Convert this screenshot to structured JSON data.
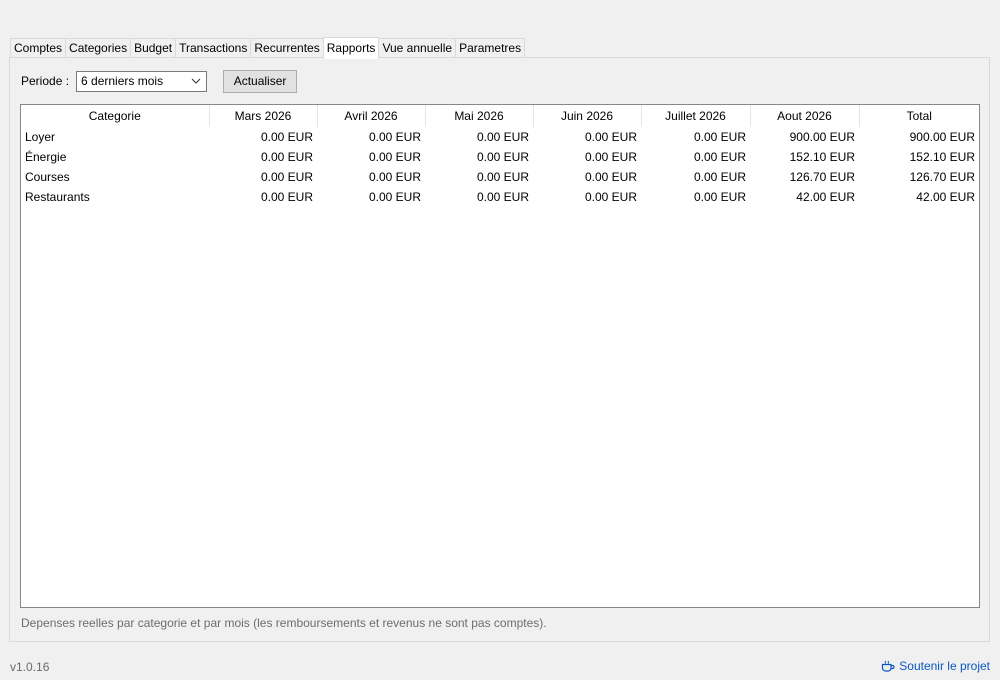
{
  "tabs": [
    "Comptes",
    "Categories",
    "Budget",
    "Transactions",
    "Recurrentes",
    "Rapports",
    "Vue annuelle",
    "Parametres"
  ],
  "active_tab": "Rapports",
  "filter": {
    "label": "Periode :",
    "selected": "6 derniers mois",
    "refresh_label": "Actualiser"
  },
  "table": {
    "headers": [
      "Categorie",
      "Mars 2026",
      "Avril 2026",
      "Mai 2026",
      "Juin 2026",
      "Juillet 2026",
      "Aout 2026",
      "Total"
    ],
    "rows": [
      [
        "Loyer",
        "0.00 EUR",
        "0.00 EUR",
        "0.00 EUR",
        "0.00 EUR",
        "0.00 EUR",
        "900.00 EUR",
        "900.00 EUR"
      ],
      [
        "Énergie",
        "0.00 EUR",
        "0.00 EUR",
        "0.00 EUR",
        "0.00 EUR",
        "0.00 EUR",
        "152.10 EUR",
        "152.10 EUR"
      ],
      [
        "Courses",
        "0.00 EUR",
        "0.00 EUR",
        "0.00 EUR",
        "0.00 EUR",
        "0.00 EUR",
        "126.70 EUR",
        "126.70 EUR"
      ],
      [
        "Restaurants",
        "0.00 EUR",
        "0.00 EUR",
        "0.00 EUR",
        "0.00 EUR",
        "0.00 EUR",
        "42.00 EUR",
        "42.00 EUR"
      ]
    ]
  },
  "footnote": "Depenses reelles par categorie et par mois (les remboursements et revenus ne sont pas comptes).",
  "footer": {
    "version": "v1.0.16",
    "support_label": "Soutenir le projet",
    "support_icon": "cup-icon"
  },
  "colors": {
    "link": "#0b57c4",
    "muted_text": "#6d6d6d"
  }
}
